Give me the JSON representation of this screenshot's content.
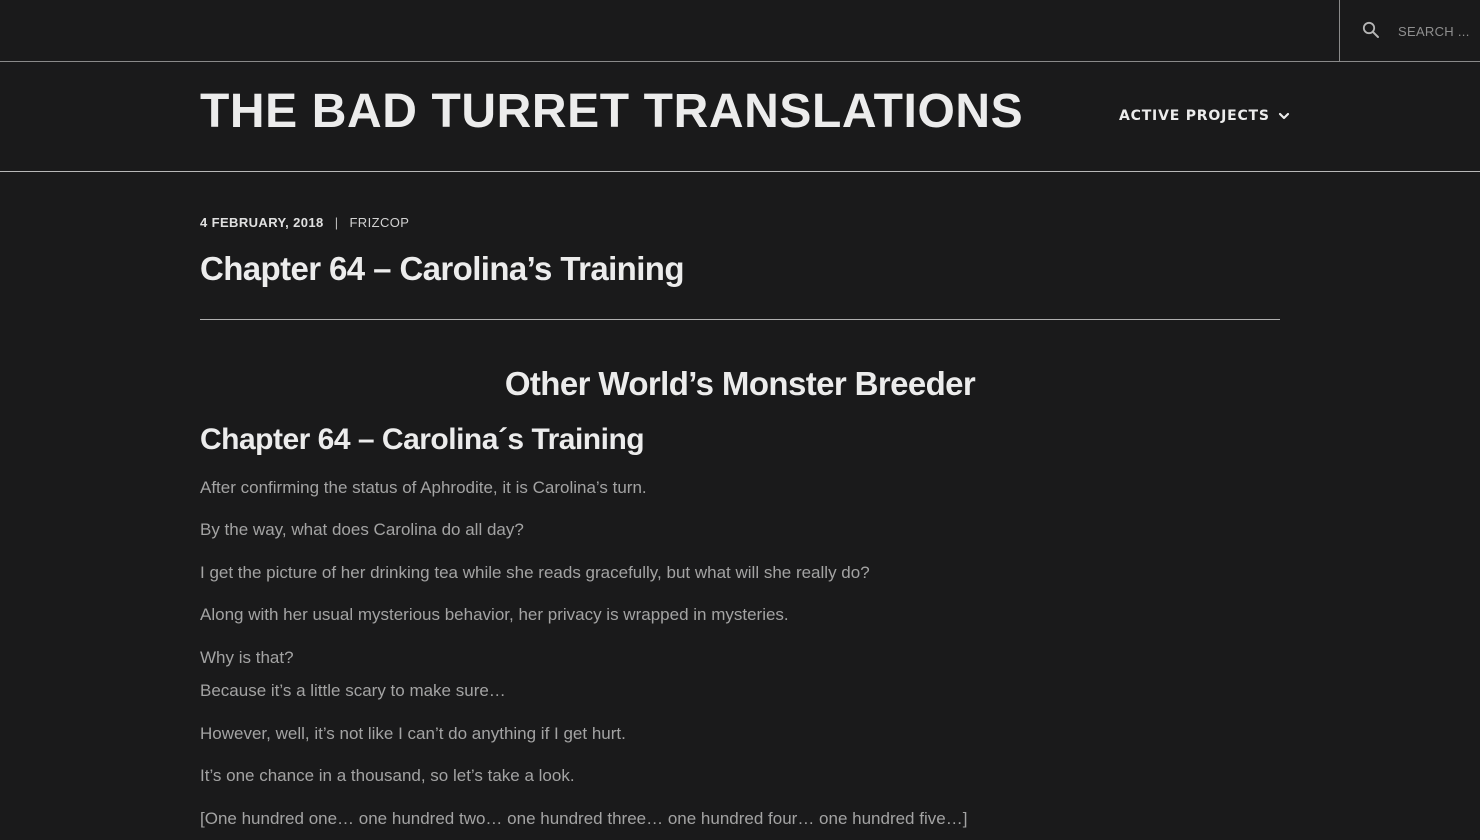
{
  "search": {
    "placeholder": "SEARCH ..."
  },
  "header": {
    "site_title": "THE BAD TURRET TRANSLATIONS",
    "nav": {
      "active_projects": "ACTIVE PROJECTS",
      "icon": "chevron-down-icon"
    }
  },
  "post": {
    "date": "4 FEBRUARY, 2018",
    "separator": "|",
    "author": "FRIZCOP",
    "title": "Chapter 64 – Carolina’s Training",
    "series_title": "Other World’s Monster Breeder",
    "chapter_heading": "Chapter 64 – Carolina´s Training",
    "paragraphs": [
      "After confirming the status of Aphrodite, it is Carolina’s turn.",
      "By the way, what does Carolina do all day?",
      "I get the picture of her drinking tea while she reads gracefully, but what will she really do?",
      "Along with her usual mysterious behavior, her privacy is wrapped in mysteries.",
      "Why is that?",
      "Because it’s a little scary to make sure…",
      "However, well, it’s not like I can’t do anything if I get hurt.",
      "It’s one chance in a thousand, so let’s take a look.",
      "[One hundred one… one hundred two… one hundred three… one hundred four… one hundred five…]"
    ]
  },
  "colors": {
    "background": "#1a1a1b",
    "heading_text": "#ececec",
    "body_text": "#a3a3a3",
    "rule": "#b0b0b0"
  }
}
